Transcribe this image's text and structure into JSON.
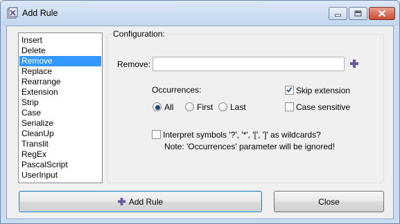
{
  "window": {
    "title": "Add Rule"
  },
  "rules": [
    {
      "label": "Insert",
      "selected": false
    },
    {
      "label": "Delete",
      "selected": false
    },
    {
      "label": "Remove",
      "selected": true
    },
    {
      "label": "Replace",
      "selected": false
    },
    {
      "label": "Rearrange",
      "selected": false
    },
    {
      "label": "Extension",
      "selected": false
    },
    {
      "label": "Strip",
      "selected": false
    },
    {
      "label": "Case",
      "selected": false
    },
    {
      "label": "Serialize",
      "selected": false
    },
    {
      "label": "CleanUp",
      "selected": false
    },
    {
      "label": "Translit",
      "selected": false
    },
    {
      "label": "RegEx",
      "selected": false
    },
    {
      "label": "PascalScript",
      "selected": false
    },
    {
      "label": "UserInput",
      "selected": false
    }
  ],
  "config": {
    "label": "Configuration:",
    "remove_label": "Remove:",
    "remove_value": "",
    "occurrences_label": "Occurrences:",
    "occurrences": [
      {
        "label": "All",
        "checked": true
      },
      {
        "label": "First",
        "checked": false
      },
      {
        "label": "Last",
        "checked": false
      }
    ],
    "skip_extension": {
      "label": "Skip extension",
      "checked": true
    },
    "case_sensitive": {
      "label": "Case sensitive",
      "checked": false
    },
    "wildcards": {
      "label": "Interpret symbols '?', '*', '[', ']' as wildcards?",
      "checked": false
    },
    "note": "Note: 'Occurrences' parameter will be ignored!"
  },
  "buttons": {
    "add_rule": "Add Rule",
    "close": "Close"
  },
  "colors": {
    "selection": "#3399ff",
    "accent_plus": "#6a5a9c"
  }
}
